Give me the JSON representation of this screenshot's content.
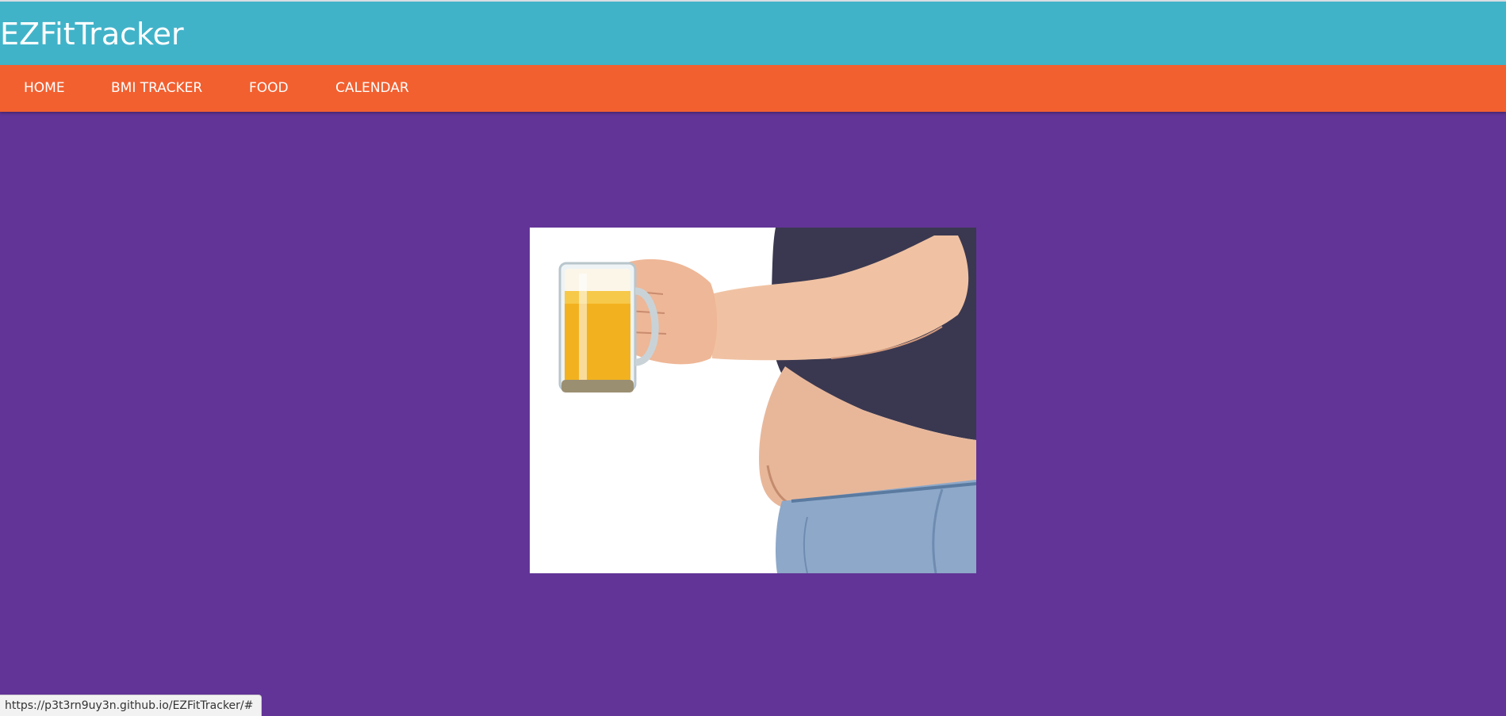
{
  "app": {
    "title": "EZFitTracker"
  },
  "nav": {
    "items": [
      {
        "label": "HOME"
      },
      {
        "label": "BMI TRACKER"
      },
      {
        "label": "FOOD"
      },
      {
        "label": "CALENDAR"
      }
    ]
  },
  "hero_image": {
    "icon": "beer-belly-photo"
  },
  "status_bar": {
    "url": "https://p3t3rn9uy3n.github.io/EZFitTracker/#"
  },
  "colors": {
    "header": "#41b3c9",
    "nav": "#f26030",
    "background": "#623497",
    "text": "#ffffff"
  }
}
